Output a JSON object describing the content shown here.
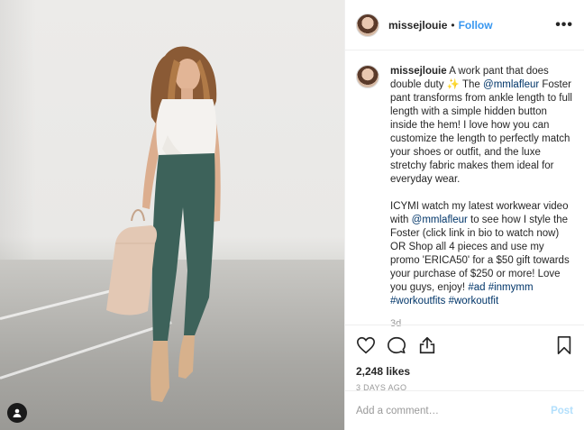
{
  "post": {
    "username": "missejlouie",
    "dot": "•",
    "follow_label": "Follow",
    "more_label": "•••"
  },
  "caption": {
    "username": "missejlouie",
    "text_1": "A work pant that does double duty",
    "sparkle": "✨",
    "text_2": "The",
    "mention_1": "@mmlafleur",
    "text_3": "Foster pant transforms from ankle length to full length with a simple hidden button inside the hem! I love how you can customize the length to perfectly match your shoes or outfit, and the luxe stretchy fabric makes them ideal for everyday wear.",
    "text_4": "ICYMI watch my latest workwear video with",
    "mention_2": "@mmlafleur",
    "text_5": "to see how I style the Foster (click link in bio to watch now) OR Shop all 4 pieces and use my promo 'ERICA50' for a $50 gift towards your purchase of $250 or more! Love you guys, enjoy!",
    "hashtags": [
      "#ad",
      "#inmymm",
      "#workoutfits",
      "#workoutfit"
    ],
    "age": "3d"
  },
  "engagement": {
    "likes": "2,248 likes",
    "date": "3 DAYS AGO"
  },
  "comment": {
    "placeholder": "Add a comment…",
    "post_label": "Post"
  },
  "icons": {
    "like": "heart-icon",
    "comment": "comment-icon",
    "share": "share-icon",
    "save": "bookmark-icon",
    "tag": "user-tag-icon"
  },
  "colors": {
    "link": "#003569",
    "follow": "#3897f0",
    "post_disabled": "#b2dffc",
    "muted": "#999999"
  }
}
